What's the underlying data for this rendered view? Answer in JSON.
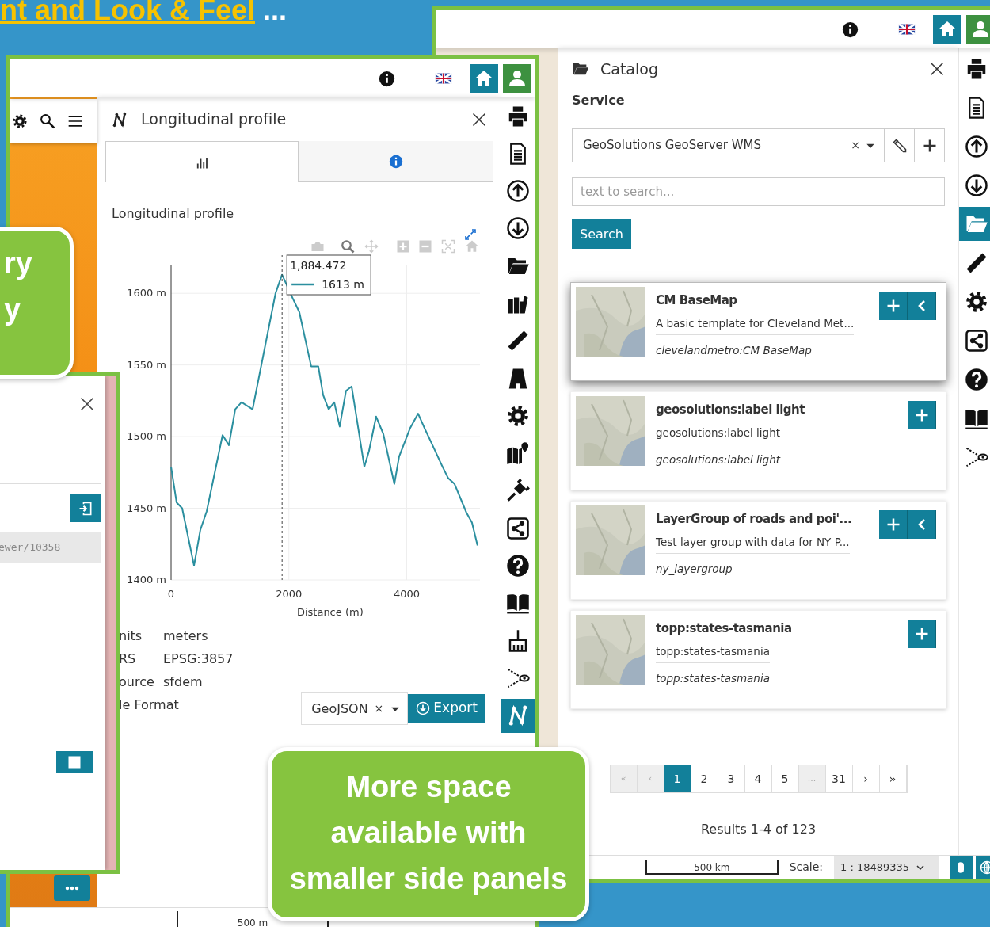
{
  "slide": {
    "heading": "nt and Look & Feel",
    "heading_suffix": "...",
    "callouts": [
      {
        "lines": [
          "ry",
          "y"
        ]
      },
      {
        "lines": [
          "More space",
          "available with",
          "smaller side panels"
        ]
      }
    ]
  },
  "catalog_window": {
    "tools": [
      {
        "selected": false
      },
      {
        "selected": false
      },
      {
        "selected": false
      },
      {
        "selected": false
      },
      {
        "selected": true
      },
      {
        "selected": false
      },
      {
        "selected": false
      },
      {
        "selected": false
      },
      {
        "selected": false
      },
      {
        "selected": false
      },
      {
        "selected": false
      }
    ],
    "panel_title": "Catalog",
    "service_label": "Service",
    "service_value": "GeoSolutions GeoServer WMS",
    "clear_mark": "×",
    "search_placeholder": "text to search...",
    "search_button": "Search",
    "results": [
      {
        "title": "CM BaseMap",
        "description": "A basic template for Cleveland Met...",
        "name": "clevelandmetro:CM BaseMap",
        "has_back": true,
        "highlighted": true
      },
      {
        "title": "geosolutions:label light",
        "description": "geosolutions:label light",
        "name": "geosolutions:label light",
        "has_back": false,
        "highlighted": false
      },
      {
        "title": "LayerGroup of roads and poi'...",
        "description": "Test layer group with data for NY P...",
        "name": "ny_layergroup",
        "has_back": true,
        "highlighted": false
      },
      {
        "title": "topp:states-tasmania",
        "description": "topp:states-tasmania",
        "name": "topp:states-tasmania",
        "has_back": false,
        "highlighted": false
      }
    ],
    "pagination": [
      {
        "label": "«",
        "selected": false,
        "disabled": true
      },
      {
        "label": "‹",
        "selected": false,
        "disabled": true
      },
      {
        "label": "1",
        "selected": true,
        "disabled": false
      },
      {
        "label": "2",
        "selected": false,
        "disabled": false
      },
      {
        "label": "3",
        "selected": false,
        "disabled": false
      },
      {
        "label": "4",
        "selected": false,
        "disabled": false
      },
      {
        "label": "5",
        "selected": false,
        "disabled": false
      },
      {
        "label": "...",
        "selected": false,
        "disabled": true
      },
      {
        "label": "31",
        "selected": false,
        "disabled": false
      },
      {
        "label": "›",
        "selected": false,
        "disabled": false
      },
      {
        "label": "»",
        "selected": false,
        "disabled": false
      }
    ],
    "results_summary": "Results 1-4 of 123",
    "scale_bar": "500 km",
    "scale_label": "Scale:",
    "scale_value": "1 : 18489335"
  },
  "profile_window": {
    "tools": [
      {
        "selected": false
      },
      {
        "selected": false
      },
      {
        "selected": false
      },
      {
        "selected": false
      },
      {
        "selected": false
      },
      {
        "selected": false
      },
      {
        "selected": false
      },
      {
        "selected": false
      },
      {
        "selected": false
      },
      {
        "selected": false
      },
      {
        "selected": false
      },
      {
        "selected": false
      },
      {
        "selected": false
      },
      {
        "selected": false
      },
      {
        "selected": false
      },
      {
        "selected": false
      },
      {
        "selected": true
      }
    ],
    "panel_title": "Longitudinal profile",
    "tabs": [
      {
        "selected": true
      },
      {
        "selected": false
      }
    ],
    "chart_title": "Longitudinal profile",
    "chart_data": {
      "type": "line",
      "xlabel": "Distance (m)",
      "xlim": [
        0,
        5230
      ],
      "ylim": [
        1400,
        1620
      ],
      "xticks": [
        0,
        2000,
        4000
      ],
      "yticks": [
        {
          "value": 1400,
          "label": "1400 m"
        },
        {
          "value": 1450,
          "label": "1450 m"
        },
        {
          "value": 1500,
          "label": "1500 m"
        },
        {
          "value": 1550,
          "label": "1550 m"
        },
        {
          "value": 1600,
          "label": "1600 m"
        }
      ],
      "x": [
        0,
        94,
        188,
        390,
        497,
        605,
        874,
        981,
        1089,
        1196,
        1384,
        1774,
        1884,
        2070,
        2177,
        2379,
        2500,
        2581,
        2675,
        2769,
        2863,
        2970,
        3065,
        3280,
        3360,
        3481,
        3602,
        3790,
        3871,
        4059,
        4194,
        4301,
        4382,
        4597,
        4704,
        4812,
        5013,
        5108,
        5202
      ],
      "series": [
        {
          "color": "#2b8f9f",
          "values": [
            1479,
            1454,
            1450,
            1410,
            1435,
            1448,
            1501,
            1494,
            1519,
            1524,
            1519,
            1600,
            1613,
            1596,
            1587,
            1549,
            1549,
            1529,
            1519,
            1524,
            1507,
            1532,
            1535,
            1479,
            1490,
            1514,
            1502,
            1467,
            1486,
            1506,
            1516,
            1506,
            1499,
            1480,
            1471,
            1467,
            1447,
            1440,
            1424
          ]
        }
      ],
      "grid": true,
      "ref_lines": [
        {
          "axis": "x",
          "value": 1884.472
        }
      ],
      "annotations": [
        "1,884.472",
        "1613 m"
      ]
    },
    "info": [
      {
        "label": "nits",
        "value": "meters"
      },
      {
        "label": "RS",
        "value": "EPSG:3857"
      },
      {
        "label": "ource",
        "value": "sfdem"
      },
      {
        "label": "le Format"
      }
    ],
    "format_value": "GeoJSON",
    "clear_mark": "×",
    "export_button": "Export",
    "scale_bar": "500 m"
  },
  "side_window": {
    "field_value": "ewer/10358"
  }
}
